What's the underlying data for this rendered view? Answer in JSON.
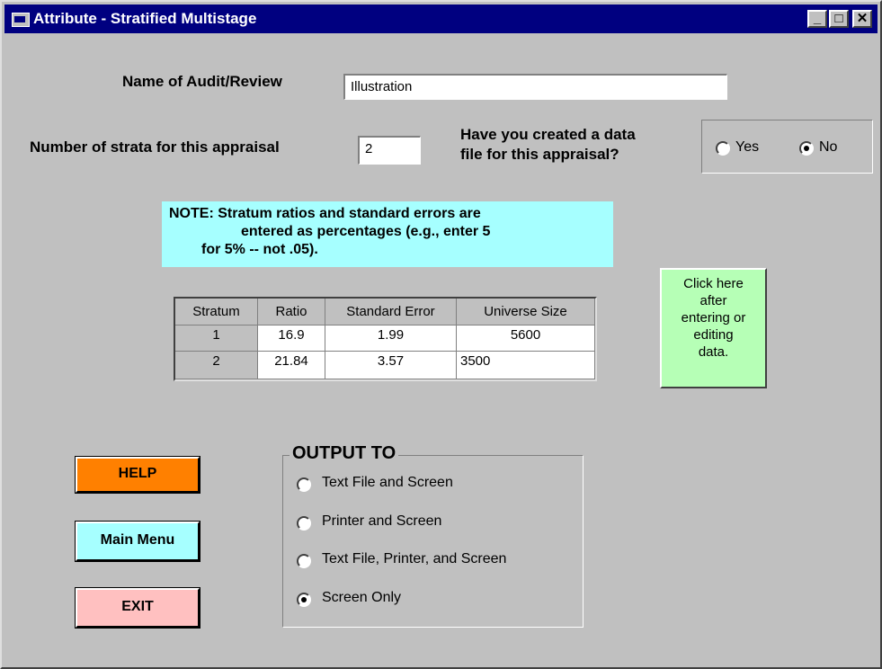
{
  "window": {
    "title": "Attribute - Stratified Multistage",
    "controls": {
      "minimize": "_",
      "maximize": "□",
      "close": "✕"
    }
  },
  "form": {
    "name_label": "Name of Audit/Review",
    "name_value": "Illustration",
    "strata_label": "Number of strata for this appraisal",
    "strata_value": "2",
    "datafile_question_line1": "Have you created a data",
    "datafile_question_line2": "file for this appraisal?",
    "datafile_options": {
      "yes": "Yes",
      "no": "No",
      "selected": "No"
    }
  },
  "note": {
    "line1": "NOTE: Stratum ratios and standard errors are",
    "line2": "entered as percentages (e.g., enter 5",
    "line3": "for 5% -- not .05)."
  },
  "table": {
    "headers": [
      "Stratum",
      "Ratio",
      "Standard Error",
      "Universe Size"
    ],
    "rows": [
      [
        "1",
        "16.9",
        "1.99",
        "5600"
      ],
      [
        "2",
        "21.84",
        "3.57",
        "3500"
      ]
    ]
  },
  "update_button": {
    "line1": "Click here",
    "line2": "after",
    "line3": "entering or",
    "line4": "editing",
    "line5": "data."
  },
  "buttons": {
    "help": "HELP",
    "main_menu": "Main Menu",
    "exit": "EXIT",
    "colors": {
      "help": "#ff8000",
      "main_menu": "#a6ffff",
      "exit": "#ffc0c0",
      "update": "#b6ffb6"
    }
  },
  "output": {
    "legend": "OUTPUT TO",
    "options": [
      "Text File and Screen",
      "Printer and Screen",
      "Text File, Printer, and Screen",
      "Screen Only"
    ],
    "selected": "Screen Only"
  }
}
